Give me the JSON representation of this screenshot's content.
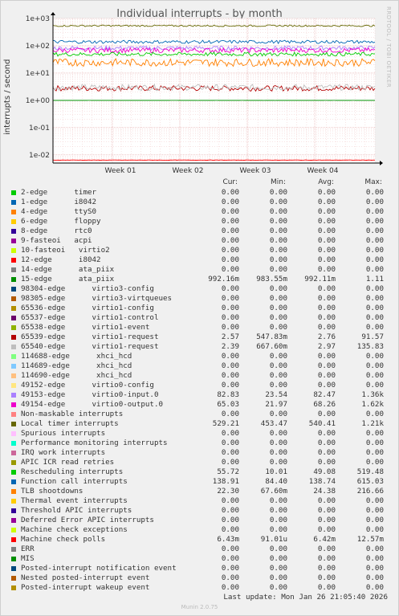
{
  "title": "Individual interrupts - by month",
  "watermark": "RRDTOOL / TOBI OETIKER",
  "footer_update": "Last update:  Mon Jan 26 21:05:40 2026",
  "footer_munin": "Munin 2.0.75",
  "chart_data": {
    "type": "line",
    "title": "Individual interrupts - by month",
    "ylabel": "interrupts / second",
    "yscale": "log",
    "ylim": [
      0.005,
      1000
    ],
    "y_ticks": [
      "1e-02",
      "1e-01",
      "1e+00",
      "1e+01",
      "1e+02",
      "1e+03"
    ],
    "x_ticks": [
      "Week 01",
      "Week 02",
      "Week 03",
      "Week 04"
    ],
    "grid": true,
    "legend_columns": [
      "Cur:",
      "Min:",
      "Avg:",
      "Max:"
    ],
    "series": [
      {
        "name": "2-edge      timer",
        "color": "#00cc00",
        "values": [
          "0.00",
          "0.00",
          "0.00",
          "0.00"
        ]
      },
      {
        "name": "1-edge      i8042",
        "color": "#0066b3",
        "values": [
          "0.00",
          "0.00",
          "0.00",
          "0.00"
        ]
      },
      {
        "name": "4-edge      ttyS0",
        "color": "#ff8000",
        "values": [
          "0.00",
          "0.00",
          "0.00",
          "0.00"
        ]
      },
      {
        "name": "6-edge      floppy",
        "color": "#ffcc00",
        "values": [
          "0.00",
          "0.00",
          "0.00",
          "0.00"
        ]
      },
      {
        "name": "8-edge      rtc0",
        "color": "#330099",
        "values": [
          "0.00",
          "0.00",
          "0.00",
          "0.00"
        ]
      },
      {
        "name": "9-fasteoi   acpi",
        "color": "#990099",
        "values": [
          "0.00",
          "0.00",
          "0.00",
          "0.00"
        ]
      },
      {
        "name": "10-fasteoi   virtio2",
        "color": "#ccff00",
        "values": [
          "0.00",
          "0.00",
          "0.00",
          "0.00"
        ]
      },
      {
        "name": "12-edge      i8042",
        "color": "#ff0000",
        "values": [
          "0.00",
          "0.00",
          "0.00",
          "0.00"
        ]
      },
      {
        "name": "14-edge      ata_piix",
        "color": "#808080",
        "values": [
          "0.00",
          "0.00",
          "0.00",
          "0.00"
        ]
      },
      {
        "name": "15-edge      ata_piix",
        "color": "#008f00",
        "values": [
          "992.16m",
          "983.55m",
          "992.11m",
          "1.11"
        ]
      },
      {
        "name": "98304-edge      virtio3-config",
        "color": "#00487d",
        "values": [
          "0.00",
          "0.00",
          "0.00",
          "0.00"
        ]
      },
      {
        "name": "98305-edge      virtio3-virtqueues",
        "color": "#b35a00",
        "values": [
          "0.00",
          "0.00",
          "0.00",
          "0.00"
        ]
      },
      {
        "name": "65536-edge      virtio1-config",
        "color": "#b38f00",
        "values": [
          "0.00",
          "0.00",
          "0.00",
          "0.00"
        ]
      },
      {
        "name": "65537-edge      virtio1-control",
        "color": "#6b006b",
        "values": [
          "0.00",
          "0.00",
          "0.00",
          "0.00"
        ]
      },
      {
        "name": "65538-edge      virtio1-event",
        "color": "#8fb300",
        "values": [
          "0.00",
          "0.00",
          "0.00",
          "0.00"
        ]
      },
      {
        "name": "65539-edge      virtio1-request",
        "color": "#b30000",
        "values": [
          "2.57",
          "547.83m",
          "2.76",
          "91.57"
        ]
      },
      {
        "name": "65540-edge      virtio1-request",
        "color": "#bebebe",
        "values": [
          "2.39",
          "667.60m",
          "2.97",
          "135.83"
        ]
      },
      {
        "name": "114688-edge      xhci_hcd",
        "color": "#80ff80",
        "values": [
          "0.00",
          "0.00",
          "0.00",
          "0.00"
        ]
      },
      {
        "name": "114689-edge      xhci_hcd",
        "color": "#80c9ff",
        "values": [
          "0.00",
          "0.00",
          "0.00",
          "0.00"
        ]
      },
      {
        "name": "114690-edge      xhci_hcd",
        "color": "#ffc080",
        "values": [
          "0.00",
          "0.00",
          "0.00",
          "0.00"
        ]
      },
      {
        "name": "49152-edge      virtio0-config",
        "color": "#ffe680",
        "values": [
          "0.00",
          "0.00",
          "0.00",
          "0.00"
        ]
      },
      {
        "name": "49153-edge      virtio0-input.0",
        "color": "#aa80ff",
        "values": [
          "82.83",
          "23.54",
          "82.47",
          "1.36k"
        ]
      },
      {
        "name": "49154-edge      virtio0-output.0",
        "color": "#ee00cc",
        "values": [
          "65.03",
          "21.97",
          "68.26",
          "1.62k"
        ]
      },
      {
        "name": "Non-maskable interrupts",
        "color": "#ff8080",
        "values": [
          "0.00",
          "0.00",
          "0.00",
          "0.00"
        ]
      },
      {
        "name": "Local timer interrupts",
        "color": "#666600",
        "values": [
          "529.21",
          "453.47",
          "540.41",
          "1.21k"
        ]
      },
      {
        "name": "Spurious interrupts",
        "color": "#ffbfff",
        "values": [
          "0.00",
          "0.00",
          "0.00",
          "0.00"
        ]
      },
      {
        "name": "Performance monitoring interrupts",
        "color": "#00ffcc",
        "values": [
          "0.00",
          "0.00",
          "0.00",
          "0.00"
        ]
      },
      {
        "name": "IRQ work interrupts",
        "color": "#cc6699",
        "values": [
          "0.00",
          "0.00",
          "0.00",
          "0.00"
        ]
      },
      {
        "name": "APIC ICR read retries",
        "color": "#999900",
        "values": [
          "0.00",
          "0.00",
          "0.00",
          "0.00"
        ]
      },
      {
        "name": "Rescheduling interrupts",
        "color": "#00cc00",
        "values": [
          "55.72",
          "10.01",
          "49.08",
          "519.48"
        ]
      },
      {
        "name": "Function call interrupts",
        "color": "#0066b3",
        "values": [
          "138.91",
          "84.40",
          "138.74",
          "615.03"
        ]
      },
      {
        "name": "TLB shootdowns",
        "color": "#ff8000",
        "values": [
          "22.30",
          "67.60m",
          "24.38",
          "216.66"
        ]
      },
      {
        "name": "Thermal event interrupts",
        "color": "#ffcc00",
        "values": [
          "0.00",
          "0.00",
          "0.00",
          "0.00"
        ]
      },
      {
        "name": "Threshold APIC interrupts",
        "color": "#330099",
        "values": [
          "0.00",
          "0.00",
          "0.00",
          "0.00"
        ]
      },
      {
        "name": "Deferred Error APIC interrupts",
        "color": "#990099",
        "values": [
          "0.00",
          "0.00",
          "0.00",
          "0.00"
        ]
      },
      {
        "name": "Machine check exceptions",
        "color": "#ccff00",
        "values": [
          "0.00",
          "0.00",
          "0.00",
          "0.00"
        ]
      },
      {
        "name": "Machine check polls",
        "color": "#ff0000",
        "values": [
          "6.43m",
          "91.01u",
          "6.42m",
          "12.57m"
        ]
      },
      {
        "name": "ERR",
        "color": "#808080",
        "values": [
          "0.00",
          "0.00",
          "0.00",
          "0.00"
        ]
      },
      {
        "name": "MIS",
        "color": "#008f00",
        "values": [
          "0.00",
          "0.00",
          "0.00",
          "0.00"
        ]
      },
      {
        "name": "Posted-interrupt notification event",
        "color": "#00487d",
        "values": [
          "0.00",
          "0.00",
          "0.00",
          "0.00"
        ]
      },
      {
        "name": "Nested posted-interrupt event",
        "color": "#b35a00",
        "values": [
          "0.00",
          "0.00",
          "0.00",
          "0.00"
        ]
      },
      {
        "name": "Posted-interrupt wakeup event",
        "color": "#b38f00",
        "values": [
          "0.00",
          "0.00",
          "0.00",
          "0.00"
        ]
      }
    ]
  }
}
